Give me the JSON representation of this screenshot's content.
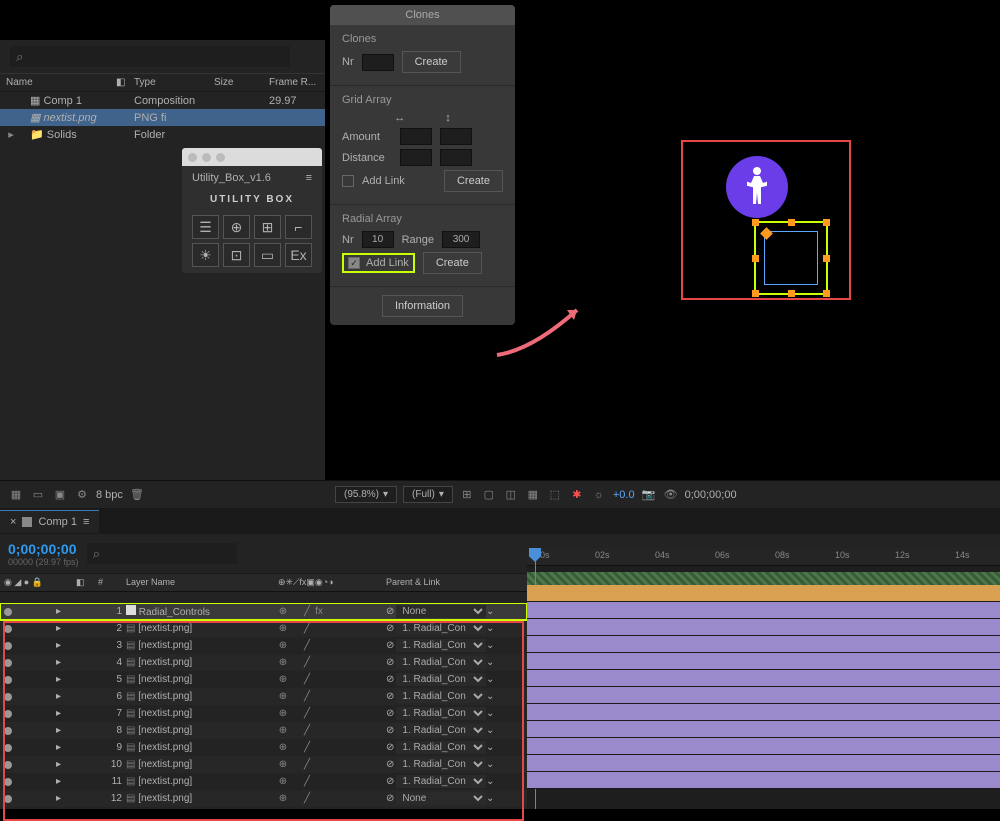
{
  "project": {
    "search_placeholder": "⌕",
    "cols": {
      "name": "Name",
      "type": "Type",
      "size": "Size",
      "frame": "Frame R..."
    },
    "items": [
      {
        "name": "Comp 1",
        "type": "Composition",
        "fr": "29.97",
        "icon": "comp"
      },
      {
        "name": "nextist.png",
        "type": "PNG fi",
        "fr": "",
        "icon": "png",
        "italic": true
      },
      {
        "name": "Solids",
        "type": "Folder",
        "fr": "",
        "icon": "folder"
      }
    ]
  },
  "utility_box": {
    "title": "Utility_Box_v1.6",
    "logo": "UTILITY BOX",
    "icons": [
      "☰",
      "⊕",
      "⊞",
      "⌐",
      "☀",
      "⊡",
      "▭",
      "Ex"
    ]
  },
  "clones": {
    "title": "Clones",
    "sect_clones": "Clones",
    "nr_label": "Nr",
    "create": "Create",
    "grid_label": "Grid Array",
    "amount": "Amount",
    "distance": "Distance",
    "add_link": "Add Link",
    "radial_label": "Radial Array",
    "radial_nr": "10",
    "range_label": "Range",
    "range": "300",
    "information": "Information"
  },
  "footer": {
    "bpc": "8 bpc",
    "zoom": "(95.8%)",
    "res": "(Full)",
    "exposure": "+0.0",
    "time": "0;00;00;00"
  },
  "timeline": {
    "tab": "Comp 1",
    "timecode": "0;00;00;00",
    "tc_sub": "00000 (29.97 fps)",
    "search": "⌕",
    "cols": {
      "hash": "#",
      "layer_name": "Layer Name",
      "switches": "⊕✳⟋fx▣◉◔◑",
      "parent": "Parent & Link"
    },
    "ruler": [
      "00s",
      "02s",
      "04s",
      "06s",
      "08s",
      "10s",
      "12s",
      "14s"
    ],
    "layers": [
      {
        "n": 1,
        "name": "Radial_Controls",
        "color": "orange",
        "file": false,
        "parent": "None",
        "hl": true,
        "label": "white"
      },
      {
        "n": 2,
        "name": "[nextist.png]",
        "color": "purple",
        "file": true,
        "parent": "1. Radial_Con"
      },
      {
        "n": 3,
        "name": "[nextist.png]",
        "color": "purple",
        "file": true,
        "parent": "1. Radial_Con"
      },
      {
        "n": 4,
        "name": "[nextist.png]",
        "color": "purple",
        "file": true,
        "parent": "1. Radial_Con"
      },
      {
        "n": 5,
        "name": "[nextist.png]",
        "color": "purple",
        "file": true,
        "parent": "1. Radial_Con"
      },
      {
        "n": 6,
        "name": "[nextist.png]",
        "color": "purple",
        "file": true,
        "parent": "1. Radial_Con"
      },
      {
        "n": 7,
        "name": "[nextist.png]",
        "color": "purple",
        "file": true,
        "parent": "1. Radial_Con"
      },
      {
        "n": 8,
        "name": "[nextist.png]",
        "color": "purple",
        "file": true,
        "parent": "1. Radial_Con"
      },
      {
        "n": 9,
        "name": "[nextist.png]",
        "color": "purple",
        "file": true,
        "parent": "1. Radial_Con"
      },
      {
        "n": 10,
        "name": "[nextist.png]",
        "color": "purple",
        "file": true,
        "parent": "1. Radial_Con"
      },
      {
        "n": 11,
        "name": "[nextist.png]",
        "color": "purple",
        "file": true,
        "parent": "1. Radial_Con"
      },
      {
        "n": 12,
        "name": "[nextist.png]",
        "color": "purple",
        "file": true,
        "parent": "None"
      }
    ]
  }
}
